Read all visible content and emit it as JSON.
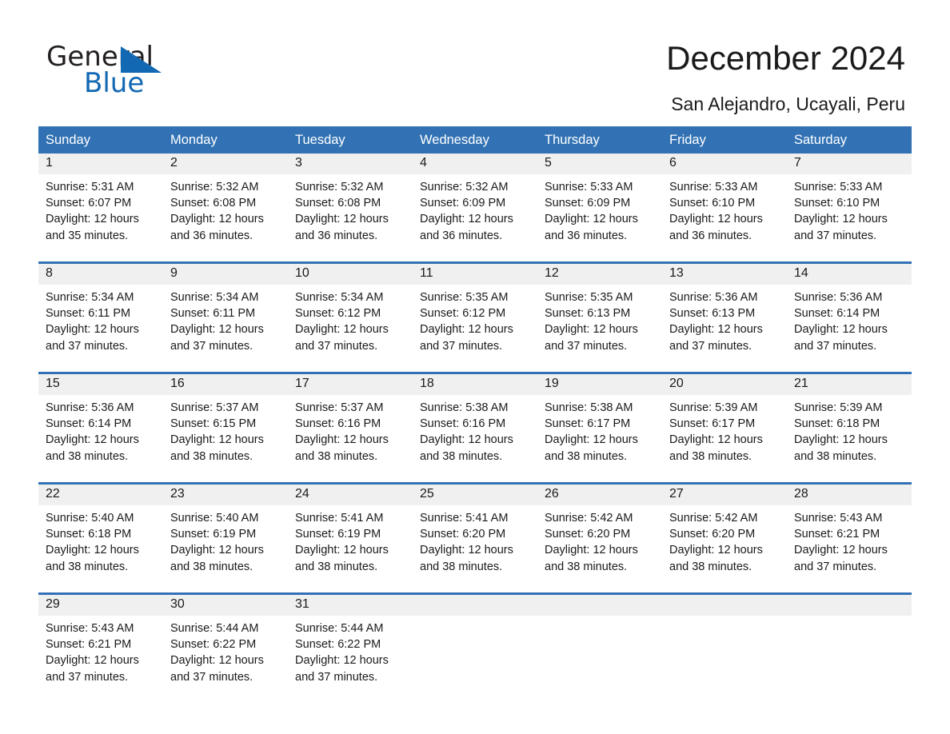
{
  "logo": {
    "word_one": "General",
    "word_two": "Blue",
    "triangle_icon": "triangle-icon"
  },
  "header": {
    "title": "December 2024",
    "subtitle": "San Alejandro, Ucayali, Peru"
  },
  "colors": {
    "header_blue": "#3272b4",
    "logo_blue": "#1268b3",
    "band_gray": "#f0f0f0",
    "text": "#1a1a1a"
  },
  "calendar": {
    "weekday_headers": [
      "Sunday",
      "Monday",
      "Tuesday",
      "Wednesday",
      "Thursday",
      "Friday",
      "Saturday"
    ],
    "weeks": [
      [
        {
          "day": "1",
          "sunrise": "Sunrise: 5:31 AM",
          "sunset": "Sunset: 6:07 PM",
          "daylight_1": "Daylight: 12 hours",
          "daylight_2": "and 35 minutes."
        },
        {
          "day": "2",
          "sunrise": "Sunrise: 5:32 AM",
          "sunset": "Sunset: 6:08 PM",
          "daylight_1": "Daylight: 12 hours",
          "daylight_2": "and 36 minutes."
        },
        {
          "day": "3",
          "sunrise": "Sunrise: 5:32 AM",
          "sunset": "Sunset: 6:08 PM",
          "daylight_1": "Daylight: 12 hours",
          "daylight_2": "and 36 minutes."
        },
        {
          "day": "4",
          "sunrise": "Sunrise: 5:32 AM",
          "sunset": "Sunset: 6:09 PM",
          "daylight_1": "Daylight: 12 hours",
          "daylight_2": "and 36 minutes."
        },
        {
          "day": "5",
          "sunrise": "Sunrise: 5:33 AM",
          "sunset": "Sunset: 6:09 PM",
          "daylight_1": "Daylight: 12 hours",
          "daylight_2": "and 36 minutes."
        },
        {
          "day": "6",
          "sunrise": "Sunrise: 5:33 AM",
          "sunset": "Sunset: 6:10 PM",
          "daylight_1": "Daylight: 12 hours",
          "daylight_2": "and 36 minutes."
        },
        {
          "day": "7",
          "sunrise": "Sunrise: 5:33 AM",
          "sunset": "Sunset: 6:10 PM",
          "daylight_1": "Daylight: 12 hours",
          "daylight_2": "and 37 minutes."
        }
      ],
      [
        {
          "day": "8",
          "sunrise": "Sunrise: 5:34 AM",
          "sunset": "Sunset: 6:11 PM",
          "daylight_1": "Daylight: 12 hours",
          "daylight_2": "and 37 minutes."
        },
        {
          "day": "9",
          "sunrise": "Sunrise: 5:34 AM",
          "sunset": "Sunset: 6:11 PM",
          "daylight_1": "Daylight: 12 hours",
          "daylight_2": "and 37 minutes."
        },
        {
          "day": "10",
          "sunrise": "Sunrise: 5:34 AM",
          "sunset": "Sunset: 6:12 PM",
          "daylight_1": "Daylight: 12 hours",
          "daylight_2": "and 37 minutes."
        },
        {
          "day": "11",
          "sunrise": "Sunrise: 5:35 AM",
          "sunset": "Sunset: 6:12 PM",
          "daylight_1": "Daylight: 12 hours",
          "daylight_2": "and 37 minutes."
        },
        {
          "day": "12",
          "sunrise": "Sunrise: 5:35 AM",
          "sunset": "Sunset: 6:13 PM",
          "daylight_1": "Daylight: 12 hours",
          "daylight_2": "and 37 minutes."
        },
        {
          "day": "13",
          "sunrise": "Sunrise: 5:36 AM",
          "sunset": "Sunset: 6:13 PM",
          "daylight_1": "Daylight: 12 hours",
          "daylight_2": "and 37 minutes."
        },
        {
          "day": "14",
          "sunrise": "Sunrise: 5:36 AM",
          "sunset": "Sunset: 6:14 PM",
          "daylight_1": "Daylight: 12 hours",
          "daylight_2": "and 37 minutes."
        }
      ],
      [
        {
          "day": "15",
          "sunrise": "Sunrise: 5:36 AM",
          "sunset": "Sunset: 6:14 PM",
          "daylight_1": "Daylight: 12 hours",
          "daylight_2": "and 38 minutes."
        },
        {
          "day": "16",
          "sunrise": "Sunrise: 5:37 AM",
          "sunset": "Sunset: 6:15 PM",
          "daylight_1": "Daylight: 12 hours",
          "daylight_2": "and 38 minutes."
        },
        {
          "day": "17",
          "sunrise": "Sunrise: 5:37 AM",
          "sunset": "Sunset: 6:16 PM",
          "daylight_1": "Daylight: 12 hours",
          "daylight_2": "and 38 minutes."
        },
        {
          "day": "18",
          "sunrise": "Sunrise: 5:38 AM",
          "sunset": "Sunset: 6:16 PM",
          "daylight_1": "Daylight: 12 hours",
          "daylight_2": "and 38 minutes."
        },
        {
          "day": "19",
          "sunrise": "Sunrise: 5:38 AM",
          "sunset": "Sunset: 6:17 PM",
          "daylight_1": "Daylight: 12 hours",
          "daylight_2": "and 38 minutes."
        },
        {
          "day": "20",
          "sunrise": "Sunrise: 5:39 AM",
          "sunset": "Sunset: 6:17 PM",
          "daylight_1": "Daylight: 12 hours",
          "daylight_2": "and 38 minutes."
        },
        {
          "day": "21",
          "sunrise": "Sunrise: 5:39 AM",
          "sunset": "Sunset: 6:18 PM",
          "daylight_1": "Daylight: 12 hours",
          "daylight_2": "and 38 minutes."
        }
      ],
      [
        {
          "day": "22",
          "sunrise": "Sunrise: 5:40 AM",
          "sunset": "Sunset: 6:18 PM",
          "daylight_1": "Daylight: 12 hours",
          "daylight_2": "and 38 minutes."
        },
        {
          "day": "23",
          "sunrise": "Sunrise: 5:40 AM",
          "sunset": "Sunset: 6:19 PM",
          "daylight_1": "Daylight: 12 hours",
          "daylight_2": "and 38 minutes."
        },
        {
          "day": "24",
          "sunrise": "Sunrise: 5:41 AM",
          "sunset": "Sunset: 6:19 PM",
          "daylight_1": "Daylight: 12 hours",
          "daylight_2": "and 38 minutes."
        },
        {
          "day": "25",
          "sunrise": "Sunrise: 5:41 AM",
          "sunset": "Sunset: 6:20 PM",
          "daylight_1": "Daylight: 12 hours",
          "daylight_2": "and 38 minutes."
        },
        {
          "day": "26",
          "sunrise": "Sunrise: 5:42 AM",
          "sunset": "Sunset: 6:20 PM",
          "daylight_1": "Daylight: 12 hours",
          "daylight_2": "and 38 minutes."
        },
        {
          "day": "27",
          "sunrise": "Sunrise: 5:42 AM",
          "sunset": "Sunset: 6:20 PM",
          "daylight_1": "Daylight: 12 hours",
          "daylight_2": "and 38 minutes."
        },
        {
          "day": "28",
          "sunrise": "Sunrise: 5:43 AM",
          "sunset": "Sunset: 6:21 PM",
          "daylight_1": "Daylight: 12 hours",
          "daylight_2": "and 37 minutes."
        }
      ],
      [
        {
          "day": "29",
          "sunrise": "Sunrise: 5:43 AM",
          "sunset": "Sunset: 6:21 PM",
          "daylight_1": "Daylight: 12 hours",
          "daylight_2": "and 37 minutes."
        },
        {
          "day": "30",
          "sunrise": "Sunrise: 5:44 AM",
          "sunset": "Sunset: 6:22 PM",
          "daylight_1": "Daylight: 12 hours",
          "daylight_2": "and 37 minutes."
        },
        {
          "day": "31",
          "sunrise": "Sunrise: 5:44 AM",
          "sunset": "Sunset: 6:22 PM",
          "daylight_1": "Daylight: 12 hours",
          "daylight_2": "and 37 minutes."
        },
        {
          "day": "",
          "sunrise": "",
          "sunset": "",
          "daylight_1": "",
          "daylight_2": ""
        },
        {
          "day": "",
          "sunrise": "",
          "sunset": "",
          "daylight_1": "",
          "daylight_2": ""
        },
        {
          "day": "",
          "sunrise": "",
          "sunset": "",
          "daylight_1": "",
          "daylight_2": ""
        },
        {
          "day": "",
          "sunrise": "",
          "sunset": "",
          "daylight_1": "",
          "daylight_2": ""
        }
      ]
    ]
  }
}
